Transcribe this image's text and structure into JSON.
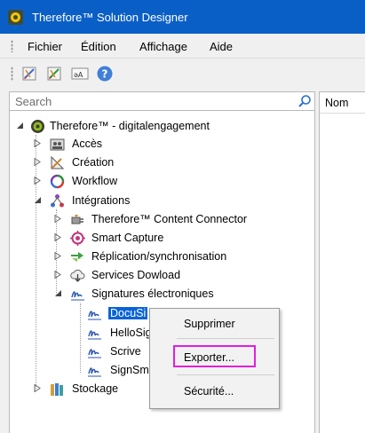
{
  "window": {
    "title": "Therefore™ Solution Designer"
  },
  "menubar": {
    "items": [
      "Fichier",
      "Édition",
      "Affichage",
      "Aide"
    ]
  },
  "toolbar": {
    "buttons": [
      "edit-icon",
      "edit-alt-icon",
      "text-style-icon",
      "help-icon"
    ]
  },
  "search": {
    "placeholder": "Search"
  },
  "right_panel": {
    "column_header": "Nom"
  },
  "tree": {
    "root": "Therefore™ - digitalengagement",
    "acces": "Accès",
    "creation": "Création",
    "workflow": "Workflow",
    "integrations": "Intégrations",
    "content_connector": "Therefore™ Content Connector",
    "smart_capture": "Smart Capture",
    "replication": "Réplication/synchronisation",
    "services_download": "Services Dowload",
    "signatures": "Signatures électroniques",
    "docusign": "DocuSi",
    "hellosign": "HelloSig",
    "scrive": "Scrive",
    "signsm": "SignSm",
    "stockage": "Stockage"
  },
  "context_menu": {
    "delete": "Supprimer",
    "export": "Exporter...",
    "security": "Sécurité..."
  },
  "colors": {
    "titlebar": "#0a5fc7",
    "selection": "#0a64d6",
    "highlight": "#e21ee0"
  }
}
